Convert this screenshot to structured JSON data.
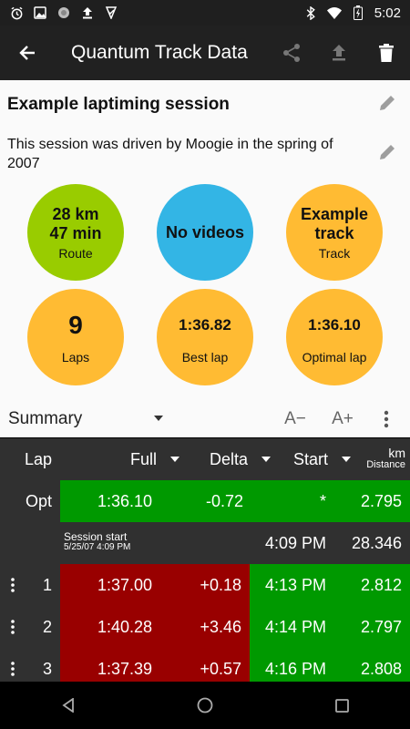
{
  "status_bar": {
    "time": "5:02",
    "left_icons": [
      "alarm-icon",
      "image-icon",
      "sync-icon",
      "upload-icon",
      "check-icon"
    ],
    "right_icons": [
      "bluetooth-icon",
      "wifi-icon",
      "battery-icon"
    ]
  },
  "app_bar": {
    "title": "Quantum Track Data",
    "icons": [
      "back-arrow-icon",
      "share-icon",
      "upload-icon",
      "delete-icon"
    ]
  },
  "session": {
    "title": "Example laptiming session",
    "description": "This session was driven by Moogie in the spring of 2007"
  },
  "circles": {
    "route": {
      "line1": "28 km",
      "line2": "47 min",
      "label": "Route"
    },
    "videos": {
      "value": "No videos"
    },
    "track": {
      "line1": "Example",
      "line2": "track",
      "label": "Track"
    },
    "laps": {
      "value": "9",
      "label": "Laps"
    },
    "best_lap": {
      "value": "1:36.82",
      "label": "Best lap"
    },
    "optimal_lap": {
      "value": "1:36.10",
      "label": "Optimal lap"
    }
  },
  "summary": {
    "selected": "Summary",
    "font_decrease": "A−",
    "font_increase": "A+"
  },
  "table": {
    "headers": {
      "lap": "Lap",
      "full": "Full",
      "delta": "Delta",
      "start": "Start",
      "distance_unit": "km",
      "distance_label": "Distance"
    },
    "opt_row": {
      "lap": "Opt",
      "full": "1:36.10",
      "delta": "-0.72",
      "start": "*",
      "distance": "2.795"
    },
    "session_row": {
      "label": "Session start",
      "sublabel": "5/25/07 4:09 PM",
      "start": "4:09 PM",
      "distance": "28.346"
    },
    "laps": [
      {
        "lap": "1",
        "full": "1:37.00",
        "delta": "+0.18",
        "start": "4:13 PM",
        "distance": "2.812"
      },
      {
        "lap": "2",
        "full": "1:40.28",
        "delta": "+3.46",
        "start": "4:14 PM",
        "distance": "2.797"
      },
      {
        "lap": "3",
        "full": "1:37.39",
        "delta": "+0.57",
        "start": "4:16 PM",
        "distance": "2.808"
      }
    ]
  },
  "colors": {
    "green": "#99cc00",
    "blue": "#33b5e5",
    "orange": "#ffbb33",
    "table_green": "#009900",
    "table_red": "#990000",
    "table_dark": "#303030"
  }
}
